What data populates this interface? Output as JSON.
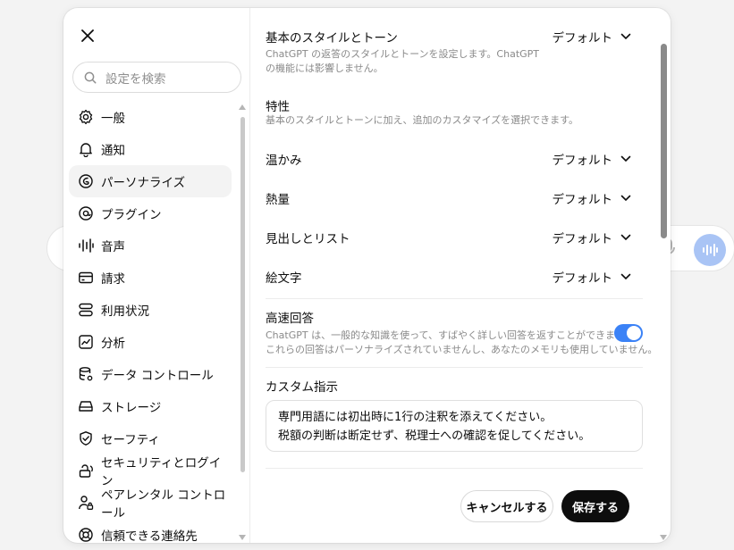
{
  "sidebar": {
    "search_placeholder": "設定を検索",
    "items": [
      {
        "label": "一般",
        "icon": "gear-icon"
      },
      {
        "label": "通知",
        "icon": "bell-icon"
      },
      {
        "label": "パーソナライズ",
        "icon": "personalize-icon",
        "active": true
      },
      {
        "label": "プラグイン",
        "icon": "plugin-icon"
      },
      {
        "label": "音声",
        "icon": "waveform-icon"
      },
      {
        "label": "請求",
        "icon": "credit-card-icon"
      },
      {
        "label": "利用状況",
        "icon": "usage-icon"
      },
      {
        "label": "分析",
        "icon": "chart-icon"
      },
      {
        "label": "データ コントロール",
        "icon": "database-icon"
      },
      {
        "label": "ストレージ",
        "icon": "storage-icon"
      },
      {
        "label": "セーフティ",
        "icon": "shield-icon"
      },
      {
        "label": "セキュリティとログイン",
        "icon": "lock-icon"
      },
      {
        "label": "ペアレンタル コントロール",
        "icon": "parental-icon"
      },
      {
        "label": "信頼できる連絡先",
        "icon": "contact-icon"
      }
    ]
  },
  "content": {
    "base_style": {
      "title": "基本のスタイルとトーン",
      "desc_line1": "ChatGPT の返答のスタイルとトーンを設定します。ChatGPT",
      "desc_line2": "の機能には影響しません。",
      "value": "デフォルト"
    },
    "traits": {
      "title": "特性",
      "desc": "基本のスタイルとトーンに加え、追加のカスタマイズを選択できます。"
    },
    "warmth": {
      "title": "温かみ",
      "value": "デフォルト"
    },
    "enthusiasm": {
      "title": "熱量",
      "value": "デフォルト"
    },
    "headings_lists": {
      "title": "見出しとリスト",
      "value": "デフォルト"
    },
    "emoji": {
      "title": "絵文字",
      "value": "デフォルト"
    },
    "fast_answer": {
      "title": "高速回答",
      "desc_line1": "ChatGPT は、一般的な知識を使って、すばやく詳しい回答を返すことができます。",
      "desc_line2": "これらの回答はパーソナライズされていませんし、あなたのメモリも使用していません。",
      "enabled": true
    },
    "custom_instructions": {
      "title": "カスタム指示",
      "line1": "専門用語には初出時に1行の注釈を添えてください。",
      "line2": "税額の判断は断定せず、税理士への確認を促してください。"
    },
    "cancel_label": "キャンセルする",
    "save_label": "保存する"
  },
  "colors": {
    "toggle_on": "#3b82f6",
    "save_button": "#0d0d0d"
  }
}
